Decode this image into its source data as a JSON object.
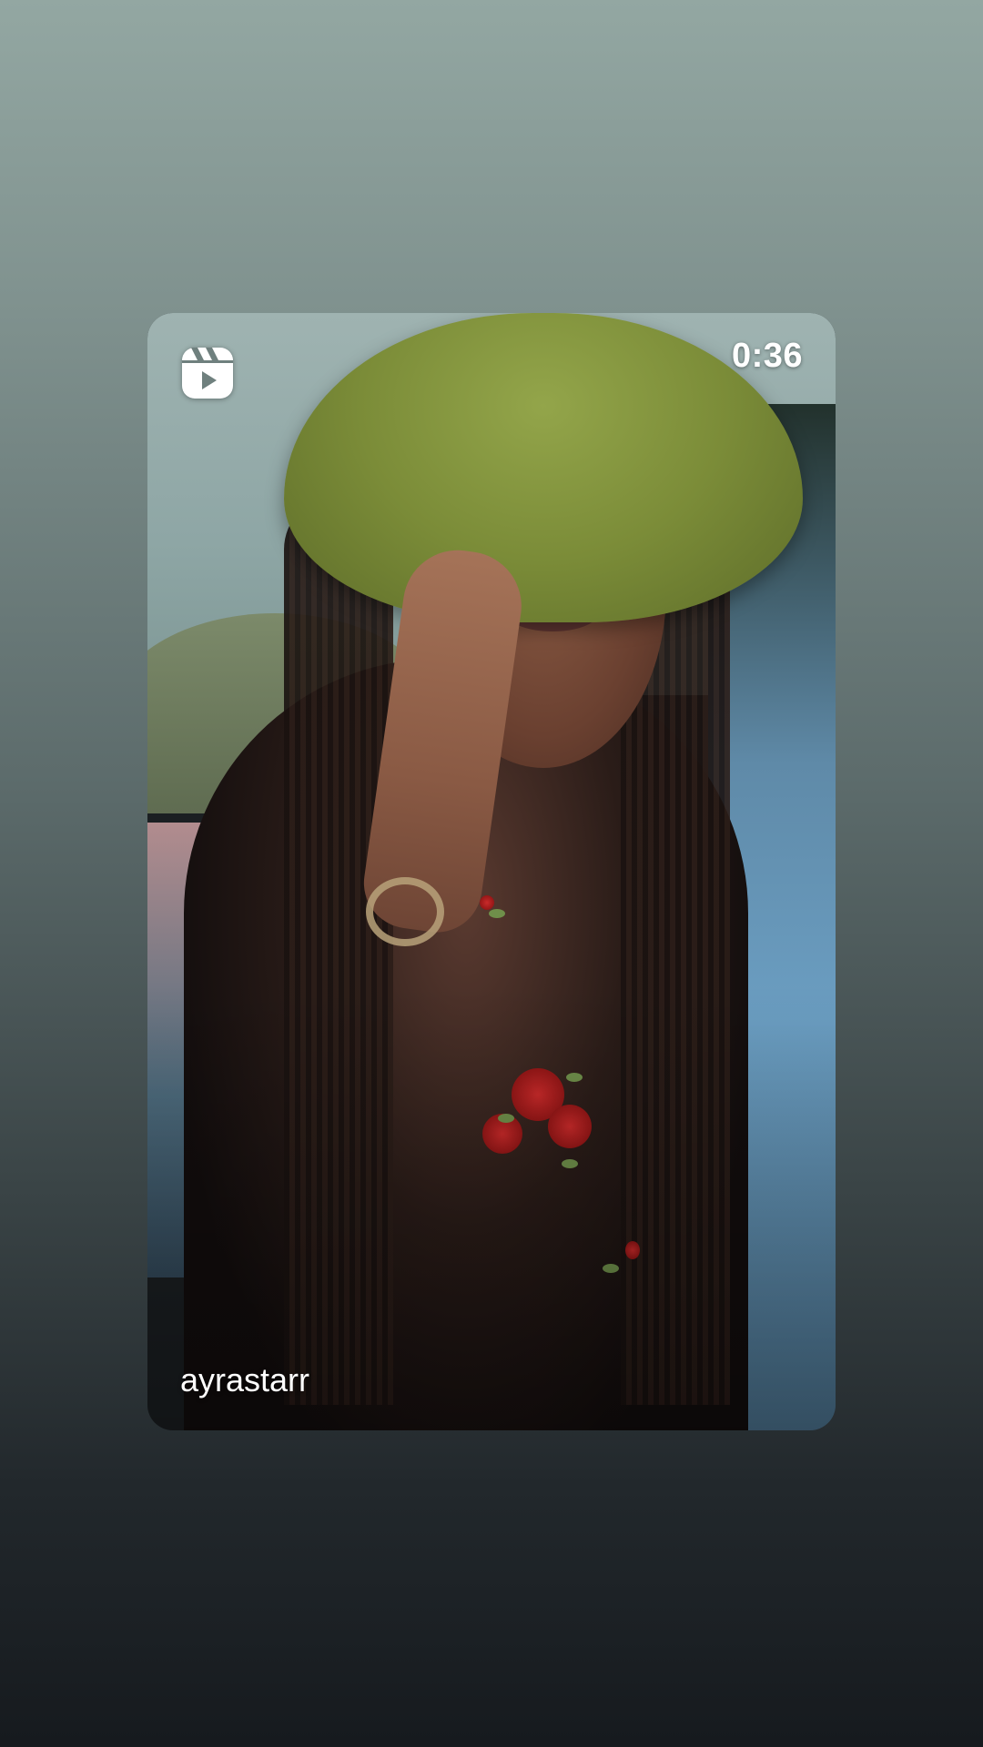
{
  "reel_card": {
    "duration": "0:36",
    "username": "ayrastarr",
    "icon": "reels-icon"
  }
}
